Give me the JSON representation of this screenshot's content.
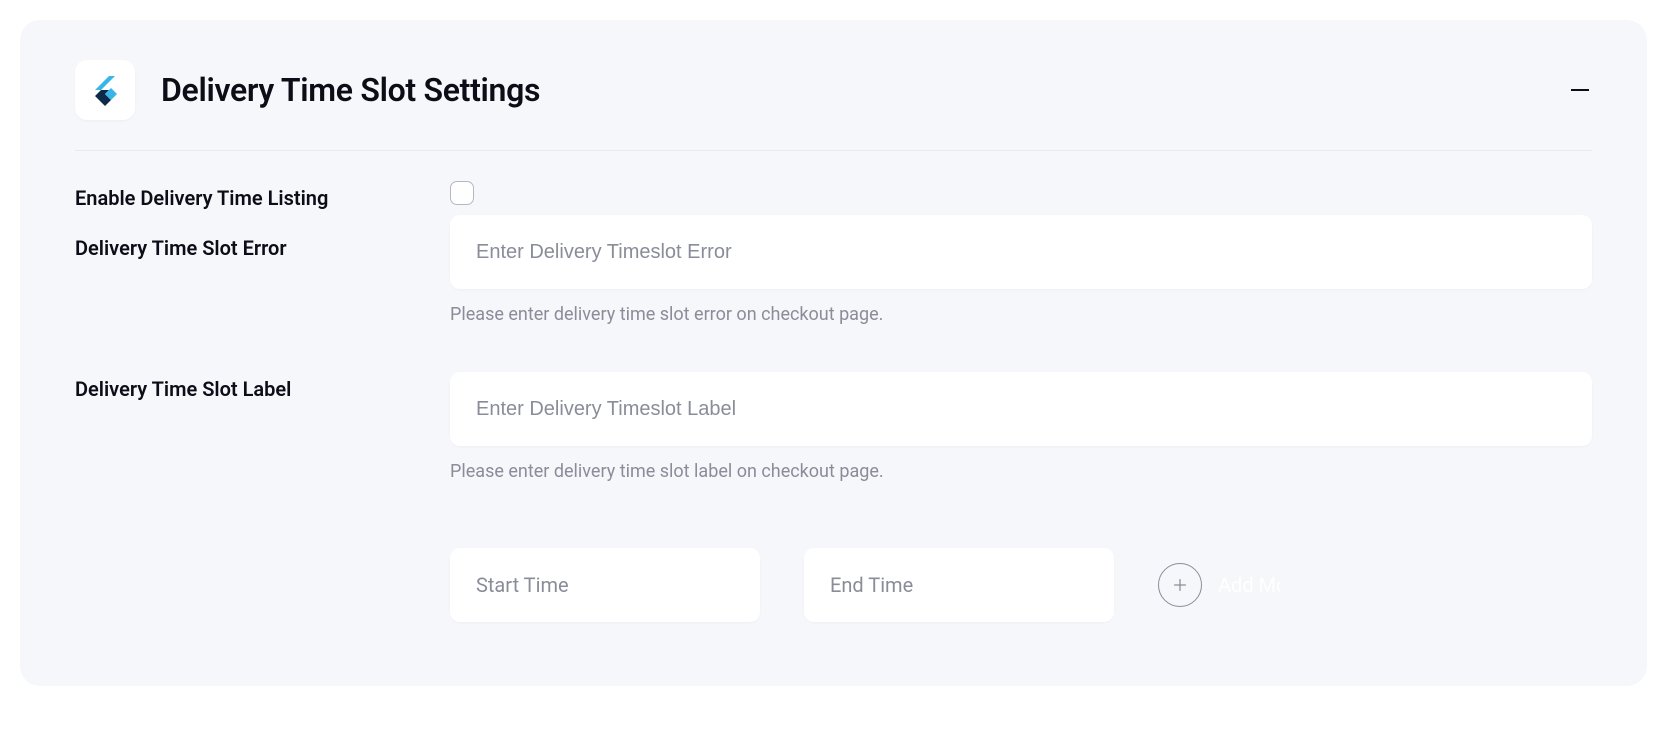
{
  "header": {
    "title": "Delivery Time Slot Settings"
  },
  "fields": {
    "enable_listing": {
      "label": "Enable Delivery Time Listing"
    },
    "error": {
      "label": "Delivery Time Slot Error",
      "placeholder": "Enter Delivery Timeslot Error",
      "help": "Please enter delivery time slot error on checkout page."
    },
    "slot_label": {
      "label": "Delivery Time Slot Label",
      "placeholder": "Enter Delivery Timeslot Label",
      "help": "Please enter delivery time slot label on checkout page."
    },
    "time_row": {
      "start_placeholder": "Start Time",
      "end_placeholder": "End Time",
      "add_more_label": "Add More"
    }
  }
}
